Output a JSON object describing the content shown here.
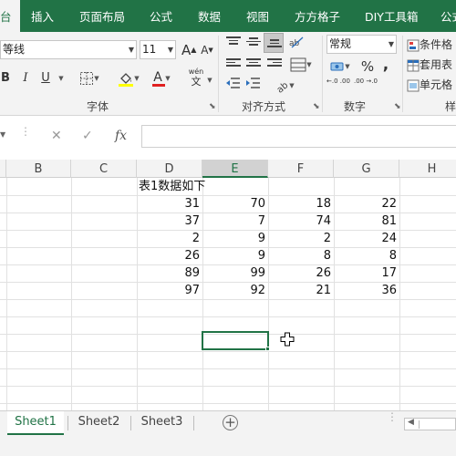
{
  "ribbon_tabs": [
    {
      "label": "台",
      "active": true
    },
    {
      "label": "插入"
    },
    {
      "label": "页面布局"
    },
    {
      "label": "公式"
    },
    {
      "label": "数据"
    },
    {
      "label": "视图"
    },
    {
      "label": "方方格子"
    },
    {
      "label": "DIY工具箱"
    },
    {
      "label": "公式"
    }
  ],
  "font_group": {
    "font_name": "等线",
    "font_size": "11",
    "grow_label": "A",
    "shrink_label": "A",
    "bold": "B",
    "italic": "I",
    "underline": "U",
    "font_color": "A",
    "phonetic_top": "wén",
    "phonetic_bottom": "文",
    "label": "字体"
  },
  "align_group": {
    "label": "对齐方式"
  },
  "number_group": {
    "format": "常规",
    "percent": "%",
    "comma": ",",
    "inc_decimal": "←.0 .00",
    "dec_decimal": ".00 →.0",
    "label": "数字"
  },
  "styles_group": {
    "cond_format": "条件格",
    "table_format": "套用表",
    "cell_styles": "单元格",
    "label": "样"
  },
  "formula_bar": {
    "cancel": "✕",
    "enter": "✓",
    "fx": "fx",
    "value": ""
  },
  "columns": [
    "B",
    "C",
    "D",
    "E",
    "F",
    "G",
    "H"
  ],
  "active_column": "E",
  "sheet": {
    "title": "表1数据如下",
    "rows": [
      [
        "31",
        "70",
        "18",
        "22"
      ],
      [
        "37",
        "7",
        "74",
        "81"
      ],
      [
        "2",
        "9",
        "2",
        "24"
      ],
      [
        "26",
        "9",
        "8",
        "8"
      ],
      [
        "89",
        "99",
        "26",
        "17"
      ],
      [
        "97",
        "92",
        "21",
        "36"
      ]
    ]
  },
  "sheet_tabs": [
    {
      "label": "Sheet1",
      "active": true
    },
    {
      "label": "Sheet2"
    },
    {
      "label": "Sheet3"
    }
  ],
  "colors": {
    "accent": "#217346",
    "ribbon_bg": "#f3f3f3",
    "font_color_bar": "#e02020",
    "highlight_bar": "#ffff00"
  }
}
